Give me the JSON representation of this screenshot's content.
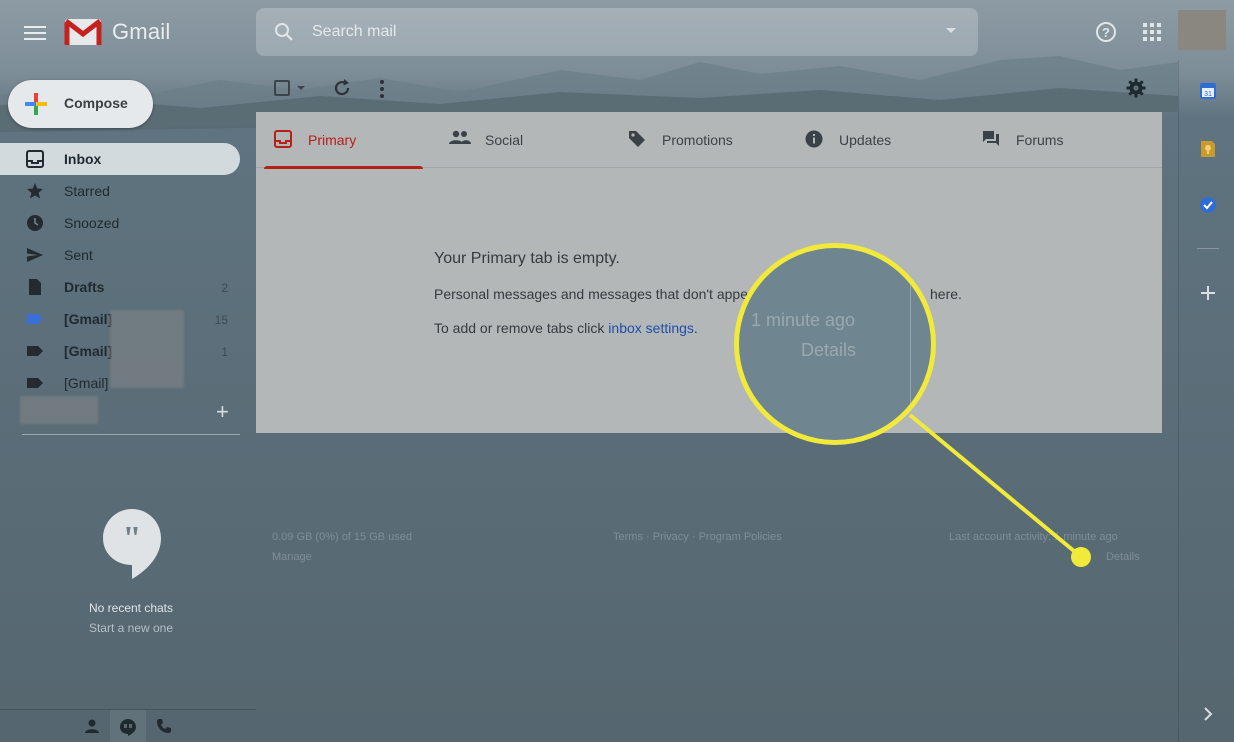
{
  "header": {
    "app_name": "Gmail",
    "search_placeholder": "Search mail"
  },
  "compose": {
    "label": "Compose"
  },
  "sidebar": {
    "items": [
      {
        "label": "Inbox",
        "count": "",
        "bold": true,
        "active": true,
        "icon": "inbox-icon"
      },
      {
        "label": "Starred",
        "count": "",
        "bold": false,
        "icon": "star-icon"
      },
      {
        "label": "Snoozed",
        "count": "",
        "bold": false,
        "icon": "clock-icon"
      },
      {
        "label": "Sent",
        "count": "",
        "bold": false,
        "icon": "send-icon"
      },
      {
        "label": "Drafts",
        "count": "2",
        "bold": true,
        "icon": "draft-icon"
      },
      {
        "label": "[Gmail]",
        "count": "15",
        "bold": true,
        "icon": "label-icon",
        "icon_color": "#3b6fd8"
      },
      {
        "label": "[Gmail]",
        "count": "1",
        "bold": true,
        "icon": "label-icon"
      },
      {
        "label": "[Gmail]",
        "count": "",
        "bold": false,
        "icon": "label-icon"
      }
    ]
  },
  "hangouts": {
    "no_chats": "No recent chats",
    "start_new": "Start a new one"
  },
  "tabs": [
    {
      "label": "Primary",
      "icon": "inbox-icon",
      "active": true
    },
    {
      "label": "Social",
      "icon": "people-icon"
    },
    {
      "label": "Promotions",
      "icon": "tag-icon"
    },
    {
      "label": "Updates",
      "icon": "info-icon"
    },
    {
      "label": "Forums",
      "icon": "forum-icon"
    }
  ],
  "empty_state": {
    "title": "Your Primary tab is empty.",
    "message_start": "Personal messages and messages that don't appe",
    "message_end": "here.",
    "tabs_text": "To add or remove tabs click ",
    "tabs_link": "inbox settings",
    "tabs_end": "."
  },
  "footer": {
    "storage": "0.09 GB (0%) of 15 GB used",
    "manage": "Manage",
    "terms": "Terms",
    "privacy": "Privacy",
    "policies": "Program Policies",
    "separator": " · ",
    "activity": "Last account activity: 1 minute ago",
    "details": "Details"
  },
  "magnifier": {
    "time": "1 minute ago",
    "details": "Details"
  },
  "colors": {
    "accent_red": "#b62017",
    "link_blue": "#1d4fa8",
    "highlight_yellow": "#f2ea3b"
  }
}
